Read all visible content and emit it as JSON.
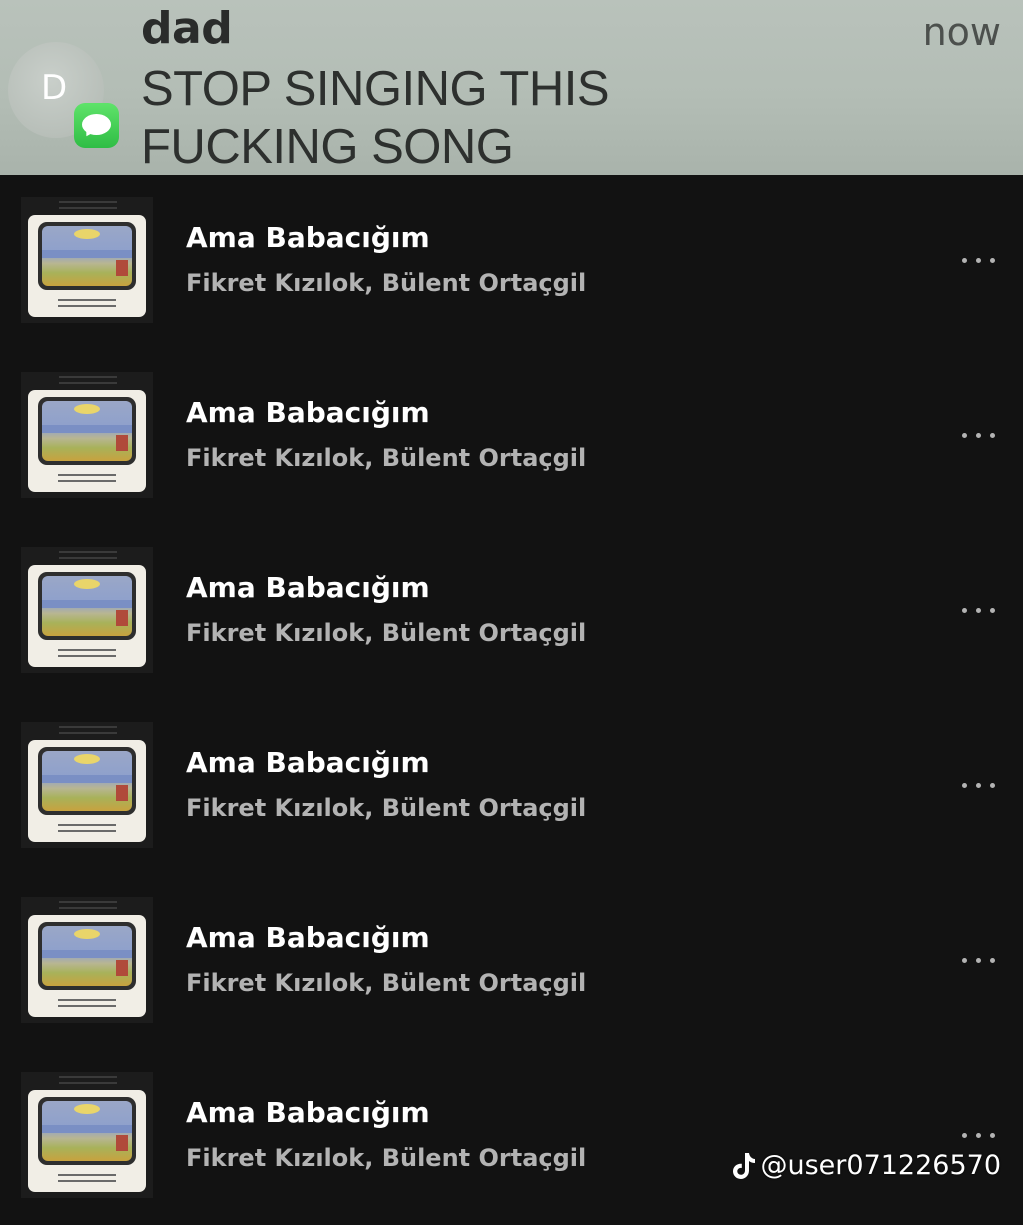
{
  "notification": {
    "avatar_initial": "D",
    "sender": "dad",
    "time": "now",
    "message": "STOP SINGING THIS FUCKING SONG",
    "app_icon": "messages-icon"
  },
  "tracks": [
    {
      "title": "Ama Babacığım",
      "artist": "Fikret Kızılok, Bülent Ortaçgil"
    },
    {
      "title": "Ama Babacığım",
      "artist": "Fikret Kızılok, Bülent Ortaçgil"
    },
    {
      "title": "Ama Babacığım",
      "artist": "Fikret Kızılok, Bülent Ortaçgil"
    },
    {
      "title": "Ama Babacığım",
      "artist": "Fikret Kızılok, Bülent Ortaçgil"
    },
    {
      "title": "Ama Babacığım",
      "artist": "Fikret Kızılok, Bülent Ortaçgil"
    },
    {
      "title": "Ama Babacığım",
      "artist": "Fikret Kızılok, Bülent Ortaçgil"
    }
  ],
  "watermark": {
    "icon": "tiktok-icon",
    "handle": "@user071226570"
  },
  "colors": {
    "background": "#121212",
    "title": "#ffffff",
    "artist": "#b3b3b3",
    "banner": "#b3bdb5",
    "messages_green": "#34c759"
  }
}
